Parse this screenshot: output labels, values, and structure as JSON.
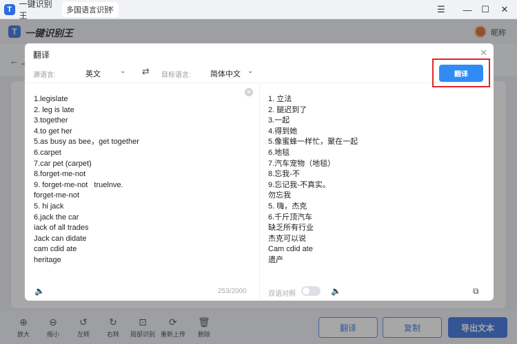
{
  "titlebar": {
    "app_tab": "一键识别王",
    "doc_tab": "多国语言识别",
    "logo_letter": "T"
  },
  "appbar": {
    "name": "一键识别王",
    "logo_letter": "T",
    "nickname": "昵称",
    "back_label": "←  上"
  },
  "dialog": {
    "title": "翻译",
    "source_label": "源语言:",
    "source_lang": "英文",
    "target_label": "目标语言:",
    "target_lang": "简体中文",
    "translate_button": "翻译",
    "source_lines": [
      "1.legislate",
      "2. leg is late",
      "3.together",
      "4.to get her",
      "5.as busy as bee，get together",
      "6.carpet",
      "7.car pet (carpet)",
      "8.forget-me-not",
      "9. forget-me-not   truelnve.",
      "forget-me-not",
      "5. hi jack",
      "6.jack the car",
      "iack of all trades",
      "Jack can didate",
      "cam cdid ate",
      "heritage"
    ],
    "target_lines": [
      "1. 立法",
      "2. 腿迟到了",
      "3.一起",
      "4.得到她",
      "5.像蜜蜂一样忙，聚在一起",
      "6.地毯",
      "7.汽车宠物（地毯）",
      "8.忘我-不",
      "9.忘记我-不真实。",
      "勿忘我",
      "5. 嗨，杰克",
      "6.千斤顶汽车",
      "缺乏所有行业",
      "杰克可以说",
      "Cam cdid ate",
      "遗产"
    ],
    "char_count": "253/2000",
    "bilingual_label": "双语对照",
    "bilingual_on": false
  },
  "toolbar": {
    "zoom_in": "放大",
    "zoom_out": "缩小",
    "rotate_left": "左转",
    "rotate_right": "右转",
    "partial_ocr": "局部识别",
    "reupload": "重新上传",
    "delete": "删除",
    "translate": "翻译",
    "copy": "复制",
    "export": "导出文本"
  },
  "colors": {
    "accent": "#2f6bde",
    "highlight_box": "#e0252b"
  }
}
